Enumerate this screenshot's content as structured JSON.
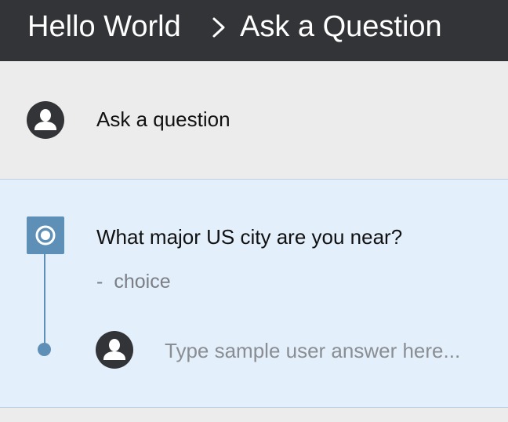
{
  "header": {
    "breadcrumb_home": "Hello World",
    "separator_icon": "chevron-right-icon",
    "breadcrumb_current": "Ask a Question",
    "background_color": "#333437"
  },
  "ask_section": {
    "avatar_icon": "user-avatar-icon",
    "label": "Ask a question"
  },
  "question_section": {
    "step_icon": "radio-step-icon",
    "question": "What major US city are you near?",
    "type_dash": "-",
    "type_label": "choice",
    "answer": {
      "avatar_icon": "user-avatar-icon",
      "value": "",
      "placeholder": "Type sample user answer here..."
    },
    "accent_color": "#5e8fb6",
    "background_color": "#e3effb"
  }
}
